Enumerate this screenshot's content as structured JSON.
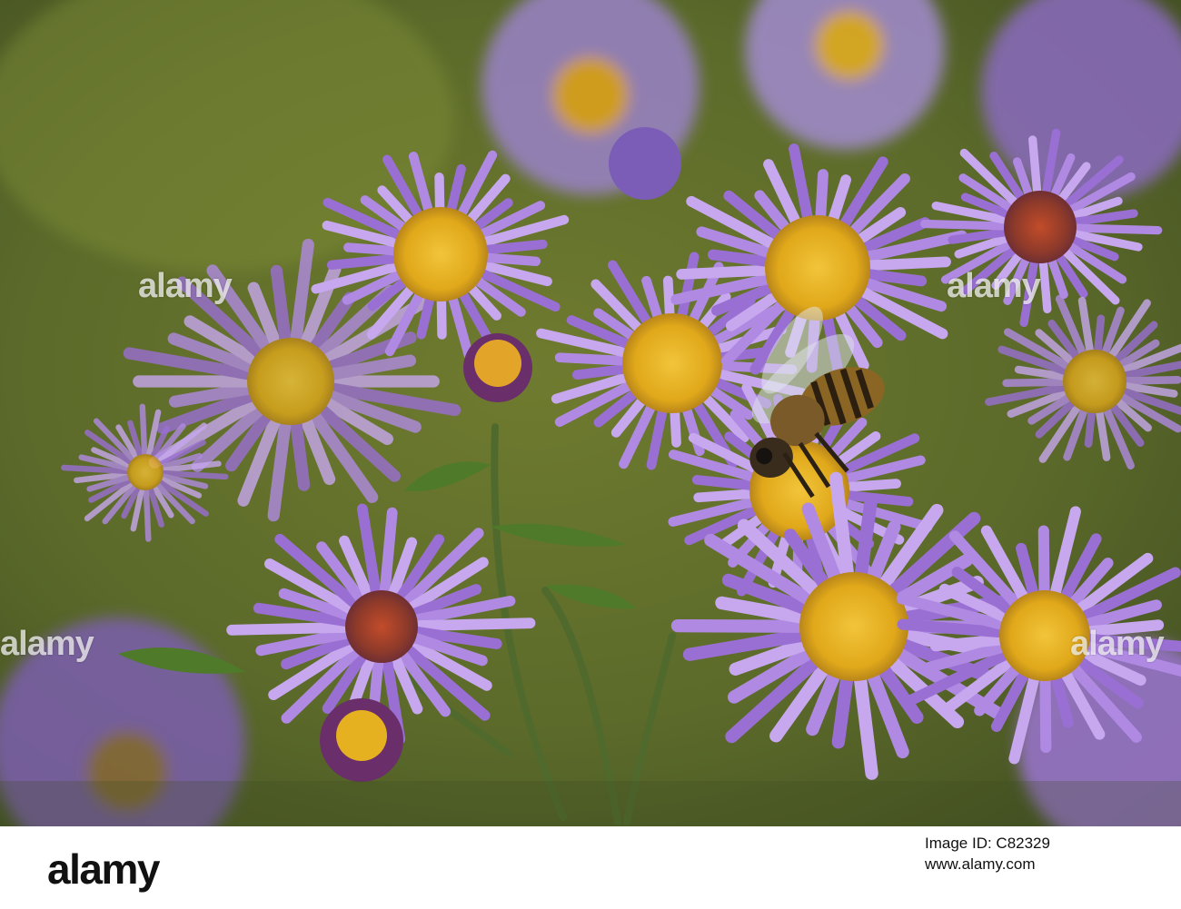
{
  "photo": {
    "subject": "honeybee-on-purple-aster-flowers",
    "palette": {
      "background_green": "#5d6a2a",
      "petal_purple": "#9a6fd3",
      "petal_light": "#c7a8ee",
      "disc_yellow": "#e8b520",
      "stem_green": "#4f6a2c"
    }
  },
  "watermark": {
    "text": "alamy"
  },
  "footer": {
    "logo": "alamy",
    "image_id": "Image ID: C82329",
    "url": "www.alamy.com"
  }
}
